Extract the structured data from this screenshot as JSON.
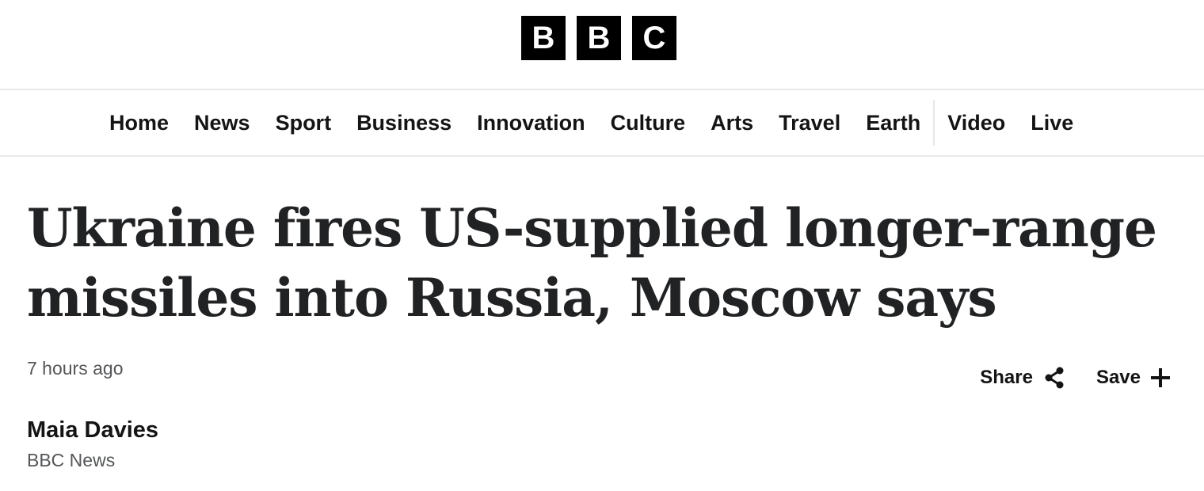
{
  "brand": {
    "logo_letters": [
      "B",
      "B",
      "C"
    ]
  },
  "nav": {
    "primary": [
      "Home",
      "News",
      "Sport",
      "Business",
      "Innovation",
      "Culture",
      "Arts",
      "Travel",
      "Earth"
    ],
    "secondary": [
      "Video",
      "Live"
    ]
  },
  "article": {
    "headline": "Ukraine fires US-supplied longer-range missiles into Russia, Moscow says",
    "timestamp": "7 hours ago",
    "author": "Maia Davies",
    "organization": "BBC News"
  },
  "actions": {
    "share_label": "Share",
    "share_icon": "share-icon",
    "save_label": "Save",
    "save_icon": "plus-icon"
  },
  "colors": {
    "text": "#202224",
    "muted": "#545658",
    "divider": "#e6e8ea",
    "logo_bg": "#000000"
  }
}
